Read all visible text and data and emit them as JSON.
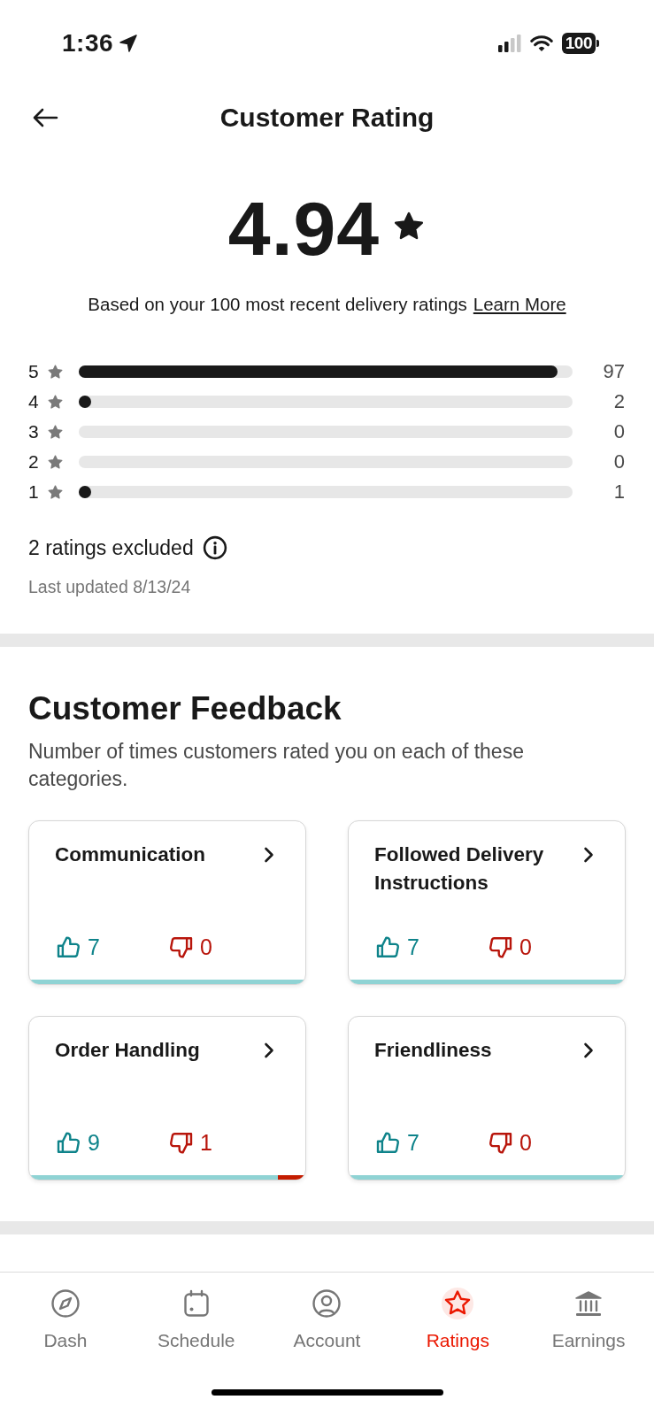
{
  "status_bar": {
    "time": "1:36",
    "battery": "100"
  },
  "header": {
    "title": "Customer Rating"
  },
  "rating": {
    "value": "4.94",
    "description": "Based on your 100 most recent delivery ratings",
    "link": "Learn More"
  },
  "distribution": [
    {
      "label": "5",
      "level": 0.97,
      "count": "97"
    },
    {
      "label": "4",
      "level": 0.02,
      "count": "2"
    },
    {
      "label": "3",
      "level": 0,
      "count": "0"
    },
    {
      "label": "2",
      "level": 0,
      "count": "0"
    },
    {
      "label": "1",
      "level": 0.01,
      "count": "1"
    }
  ],
  "excluded": {
    "text": "2 ratings excluded"
  },
  "last_updated": "Last updated 8/13/24",
  "feedback": {
    "title": "Customer Feedback",
    "description": "Number of times customers rated you on each of these categories.",
    "categories": [
      {
        "title": "Communication",
        "up": "7",
        "down": "0",
        "level": 1
      },
      {
        "title": "Followed Delivery Instructions",
        "up": "7",
        "down": "0",
        "level": 1
      },
      {
        "title": "Order Handling",
        "up": "9",
        "down": "1",
        "level": 0.9
      },
      {
        "title": "Friendliness",
        "up": "7",
        "down": "0",
        "level": 1
      }
    ]
  },
  "tab_bar": {
    "tabs": [
      {
        "label": "Dash",
        "selected": false
      },
      {
        "label": "Schedule",
        "selected": false
      },
      {
        "label": "Account",
        "selected": false
      },
      {
        "label": "Ratings",
        "selected": true
      },
      {
        "label": "Earnings",
        "selected": false
      }
    ]
  }
}
